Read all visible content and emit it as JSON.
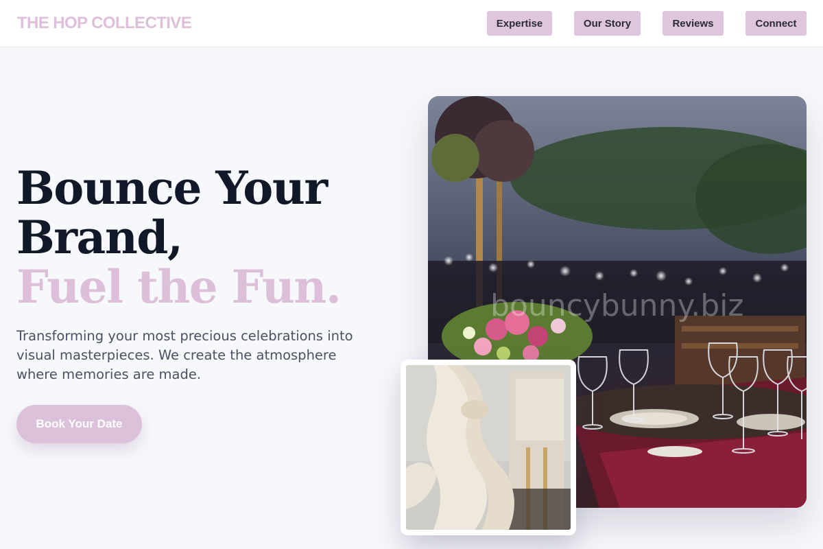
{
  "brand": {
    "name": "THE HOP COLLECTIVE",
    "accent_color": "#ddbfd9",
    "button_color": "#dec6df"
  },
  "nav": {
    "items": [
      {
        "label": "Expertise"
      },
      {
        "label": "Our Story"
      },
      {
        "label": "Reviews"
      },
      {
        "label": "Connect"
      }
    ]
  },
  "hero": {
    "headline_line1": "Bounce Your",
    "headline_line2": "Brand,",
    "headline_accent": "Fuel the Fun.",
    "subtext": "Transforming your most precious celebrations into visual masterpieces. We create the atmosphere where memories are made.",
    "cta_label": "Book Your Date"
  },
  "images": {
    "main_watermark": "bouncybunny.biz",
    "main_icon": "banquet-table-photo",
    "small_icon": "chair-sash-photo"
  }
}
